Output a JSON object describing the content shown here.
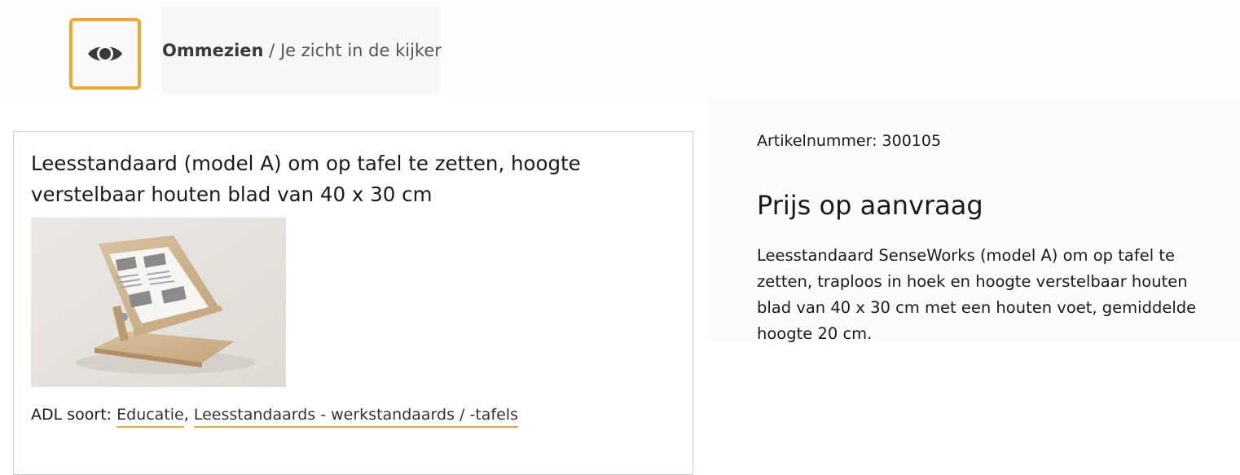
{
  "brand": {
    "name": "Ommezien",
    "separator": "/",
    "tagline": "Je zicht in de kijker",
    "accent_color": "#f2a62e",
    "logo_icon": "eye-icon"
  },
  "product": {
    "title": "Leesstandaard (model A) om op tafel te zetten, hoogte verstelbaar houten blad van 40 x 30 cm",
    "image_icon": "reading-stand-photo",
    "adl": {
      "label": "ADL soort:",
      "links": [
        "Educatie",
        "Leesstandaards - werkstandaards / -tafels"
      ],
      "separator": ","
    },
    "article_number": "Artikelnummer: 300105",
    "price": "Prijs op aanvraag",
    "description": "Leesstandaard SenseWorks (model A) om op tafel te zetten, traploos in hoek en hoogte verstelbaar houten blad van 40 x 30 cm met een houten voet, gemiddelde hoogte 20 cm."
  }
}
